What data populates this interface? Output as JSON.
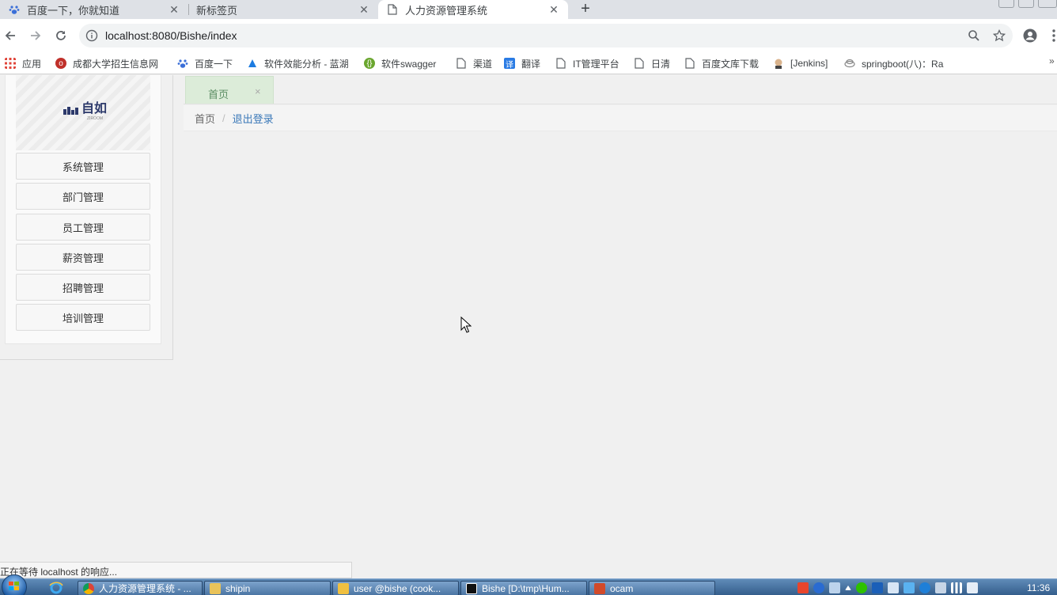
{
  "browser": {
    "tabs": [
      {
        "title": "百度一下，你就知道",
        "icon": "baidu-paw-icon",
        "active": false
      },
      {
        "title": "新标签页",
        "icon": "",
        "active": false
      },
      {
        "title": "人力资源管理系统",
        "icon": "page-icon",
        "active": true
      }
    ],
    "url": "localhost:8080/Bishe/index",
    "bookmarks": [
      {
        "label": "应用",
        "icon": "apps-grid-icon"
      },
      {
        "label": "成都大学招生信息网",
        "icon": "red-circle-icon"
      },
      {
        "label": "百度一下",
        "icon": "baidu-paw-icon"
      },
      {
        "label": "软件效能分析 - 蓝湖",
        "icon": "lanhu-icon"
      },
      {
        "label": "软件swagger",
        "icon": "swagger-icon"
      },
      {
        "label": "渠道",
        "icon": "page-icon"
      },
      {
        "label": "翻译",
        "icon": "translate-icon"
      },
      {
        "label": "IT管理平台",
        "icon": "page-icon"
      },
      {
        "label": "日清",
        "icon": "page-icon"
      },
      {
        "label": "百度文库下载",
        "icon": "page-icon"
      },
      {
        "label": "[Jenkins]",
        "icon": "jenkins-icon"
      },
      {
        "label": "springboot(八)：Ra",
        "icon": "cloud-icon"
      }
    ],
    "bookmarks_more": "»",
    "status_text": "正在等待 localhost 的响应..."
  },
  "app": {
    "logo_text": "自如",
    "logo_sub": "ZIROOM",
    "menu": [
      {
        "label": "系统管理"
      },
      {
        "label": "部门管理"
      },
      {
        "label": "员工管理"
      },
      {
        "label": "薪资管理"
      },
      {
        "label": "招聘管理"
      },
      {
        "label": "培训管理"
      }
    ],
    "content_tab": {
      "label": "首页",
      "close": "×"
    },
    "breadcrumb": {
      "home": "首页",
      "separator": "/",
      "logout": "退出登录"
    }
  },
  "taskbar": {
    "buttons": [
      {
        "label": "人力资源管理系统 - ...",
        "icon": "chrome-icon"
      },
      {
        "label": "shipin",
        "icon": "folder-icon"
      },
      {
        "label": "user @bishe (cook...",
        "icon": "database-icon"
      },
      {
        "label": "Bishe [D:\\tmp\\Hum...",
        "icon": "intellij-icon"
      },
      {
        "label": "ocam",
        "icon": "ocam-icon"
      }
    ],
    "clock": "11:36"
  },
  "colors": {
    "tab_active_bg": "#dcecd9",
    "link_blue": "#3a78b8",
    "logo_navy": "#2d3a6b"
  }
}
